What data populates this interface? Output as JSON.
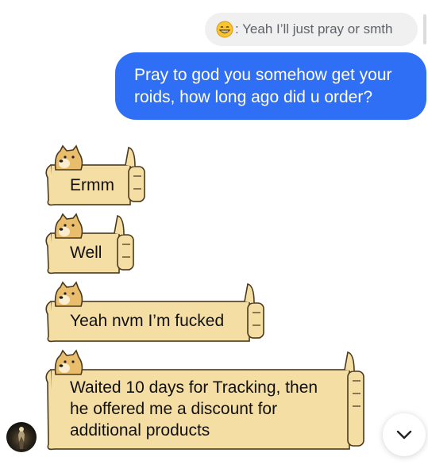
{
  "reply_preview": {
    "emoji": "grin-emoji",
    "text": ": Yeah I’ll just pray or smth"
  },
  "messages": [
    {
      "direction": "sent",
      "lines": [
        "Pray to god you somehow get your",
        "roids, how long ago did u order?"
      ]
    },
    {
      "direction": "received",
      "lines": [
        "Ermm"
      ]
    },
    {
      "direction": "received",
      "lines": [
        "Well"
      ]
    },
    {
      "direction": "received",
      "lines": [
        "Yeah nvm I’m fucked"
      ]
    },
    {
      "direction": "received",
      "lines": [
        "Waited 10 days for Tracking, then",
        "he offered me a discount for",
        "additional products"
      ]
    }
  ],
  "colors": {
    "sent_bubble": "#2f6ff5",
    "received_bubble": "#f5dea4",
    "bubble_outline": "#4a3a1c",
    "reply_pill": "#f0f0f1"
  },
  "icons": {
    "scroll_down": "chevron-down-icon",
    "sender_avatar": "avatar"
  }
}
